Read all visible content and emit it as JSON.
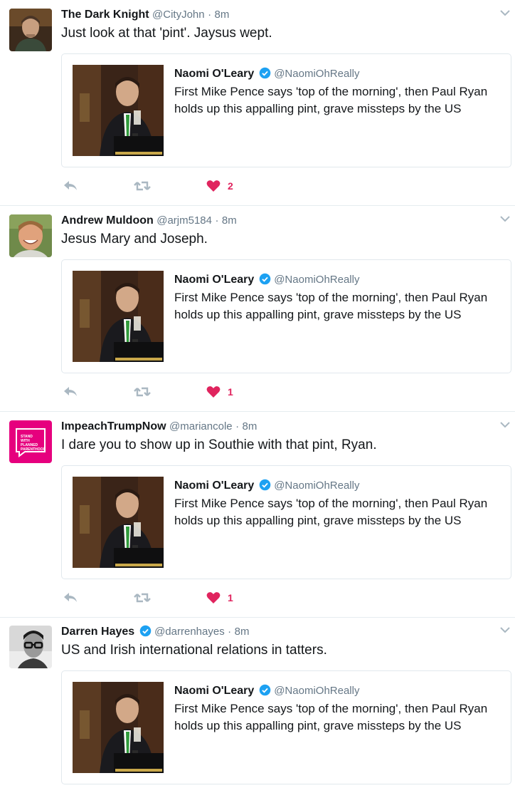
{
  "tweets": [
    {
      "name": "The Dark Knight",
      "handle": "@CityJohn",
      "separator": "·",
      "time": "8m",
      "verified": false,
      "text": "Just look at that 'pint'. Jaysus wept.",
      "avatar_icon": "avatar-man-photo-icon",
      "like_count": "2",
      "quoted": {
        "name": "Naomi O'Leary",
        "handle": "@NaomiOhReally",
        "verified": true,
        "text": "First Mike Pence says 'top of the morning', then Paul Ryan holds up this appalling pint, grave missteps by the US"
      }
    },
    {
      "name": "Andrew Muldoon",
      "handle": "@arjm5184",
      "separator": "·",
      "time": "8m",
      "verified": false,
      "text": "Jesus Mary and Joseph.",
      "avatar_icon": "avatar-smiling-man-photo-icon",
      "like_count": "1",
      "quoted": {
        "name": "Naomi O'Leary",
        "handle": "@NaomiOhReally",
        "verified": true,
        "text": "First Mike Pence says 'top of the morning', then Paul Ryan holds up this appalling pint, grave missteps by the US"
      }
    },
    {
      "name": "ImpeachTrumpNow",
      "handle": "@mariancole",
      "separator": "·",
      "time": "8m",
      "verified": false,
      "text": "I dare you to show up in Southie with that pint, Ryan.",
      "avatar_icon": "planned-parenthood-badge-icon",
      "avatar_text": [
        "STAND",
        "WITH",
        "PLANNED",
        "PARENTHOOD"
      ],
      "like_count": "1",
      "quoted": {
        "name": "Naomi O'Leary",
        "handle": "@NaomiOhReally",
        "verified": true,
        "text": "First Mike Pence says 'top of the morning', then Paul Ryan holds up this appalling pint, grave missteps by the US"
      }
    },
    {
      "name": "Darren Hayes",
      "handle": "@darrenhayes",
      "separator": "·",
      "time": "8m",
      "verified": true,
      "text": "US and Irish international relations in tatters.",
      "avatar_icon": "avatar-bw-glasses-photo-icon",
      "like_count": "",
      "quoted": {
        "name": "Naomi O'Leary",
        "handle": "@NaomiOhReally",
        "verified": true,
        "text": "First Mike Pence says 'top of the morning', then Paul Ryan holds up this appalling pint, grave missteps by the US"
      }
    }
  ],
  "colors": {
    "like": "#e0245e",
    "verified": "#1da1f2",
    "muted": "#657786",
    "border": "#e1e8ed",
    "icon": "#aab8c2",
    "avatar_pink": "#e6007e"
  }
}
